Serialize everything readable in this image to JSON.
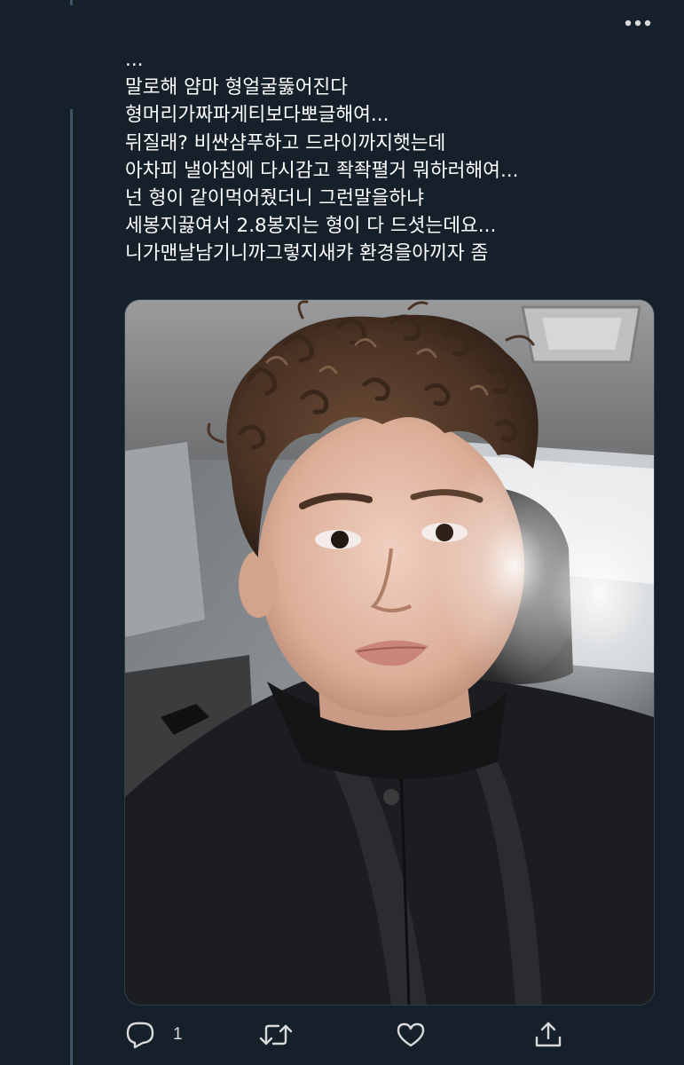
{
  "tweet": {
    "lines": [
      "...",
      "말로해 얌마 형얼굴뚫어진다",
      "형머리가짜파게티보다뽀글해여...",
      "뒤질래? 비싼샴푸하고 드라이까지햇는데",
      "아차피 낼아침에 다시감고 좍좍펼거 뭐하러해여...",
      "넌 형이 같이먹어줬더니 그런말을하냐",
      "세봉지끓여서 2.8봉지는 형이 다 드셧는데요...",
      "니가맨날남기니까그렇지새캬 환경을아끼자 좀"
    ]
  },
  "actions": {
    "reply_count": "1"
  },
  "icons": {
    "more": "more-horizontal-icon",
    "reply": "reply-icon",
    "retweet": "retweet-icon",
    "like": "heart-icon",
    "share": "share-icon"
  },
  "colors": {
    "background": "#15202b",
    "thread_line": "#3d5466",
    "text": "#ffffff",
    "icon": "#d9d9d9"
  }
}
